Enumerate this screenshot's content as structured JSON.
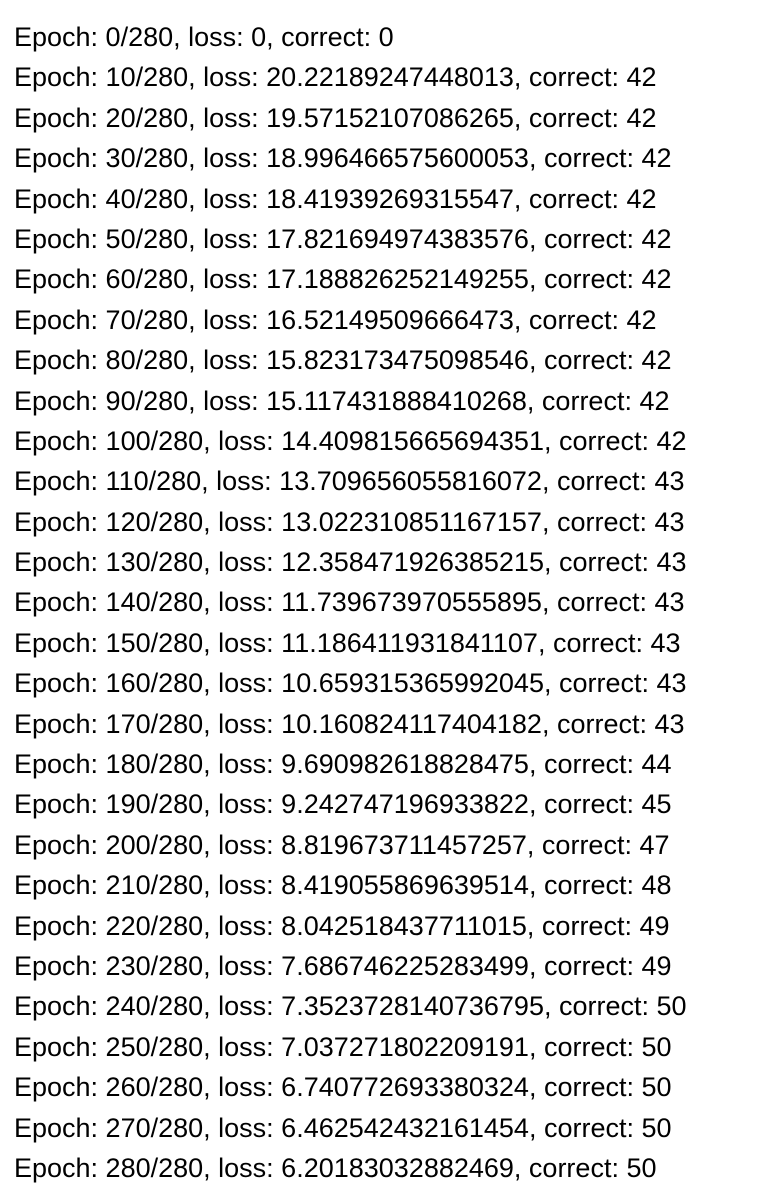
{
  "log": {
    "lines": [
      "Epoch: 0/280, loss: 0, correct: 0",
      "Epoch: 10/280, loss: 20.22189247448013, correct: 42",
      "Epoch: 20/280, loss: 19.57152107086265, correct: 42",
      "Epoch: 30/280, loss: 18.996466575600053, correct: 42",
      "Epoch: 40/280, loss: 18.41939269315547, correct: 42",
      "Epoch: 50/280, loss: 17.821694974383576, correct: 42",
      "Epoch: 60/280, loss: 17.188826252149255, correct: 42",
      "Epoch: 70/280, loss: 16.52149509666473, correct: 42",
      "Epoch: 80/280, loss: 15.823173475098546, correct: 42",
      "Epoch: 90/280, loss: 15.117431888410268, correct: 42",
      "Epoch: 100/280, loss: 14.409815665694351, correct: 42",
      "Epoch: 110/280, loss: 13.709656055816072, correct: 43",
      "Epoch: 120/280, loss: 13.022310851167157, correct: 43",
      "Epoch: 130/280, loss: 12.358471926385215, correct: 43",
      "Epoch: 140/280, loss: 11.739673970555895, correct: 43",
      "Epoch: 150/280, loss: 11.186411931841107, correct: 43",
      "Epoch: 160/280, loss: 10.659315365992045, correct: 43",
      "Epoch: 170/280, loss: 10.160824117404182, correct: 43",
      "Epoch: 180/280, loss: 9.690982618828475, correct: 44",
      "Epoch: 190/280, loss: 9.242747196933822, correct: 45",
      "Epoch: 200/280, loss: 8.819673711457257, correct: 47",
      "Epoch: 210/280, loss: 8.419055869639514, correct: 48",
      "Epoch: 220/280, loss: 8.042518437711015, correct: 49",
      "Epoch: 230/280, loss: 7.686746225283499, correct: 49",
      "Epoch: 240/280, loss: 7.3523728140736795, correct: 50",
      "Epoch: 250/280, loss: 7.037271802209191, correct: 50",
      "Epoch: 260/280, loss: 6.740772693380324, correct: 50",
      "Epoch: 270/280, loss: 6.462542432161454, correct: 50",
      "Epoch: 280/280, loss: 6.20183032882469, correct: 50"
    ]
  }
}
